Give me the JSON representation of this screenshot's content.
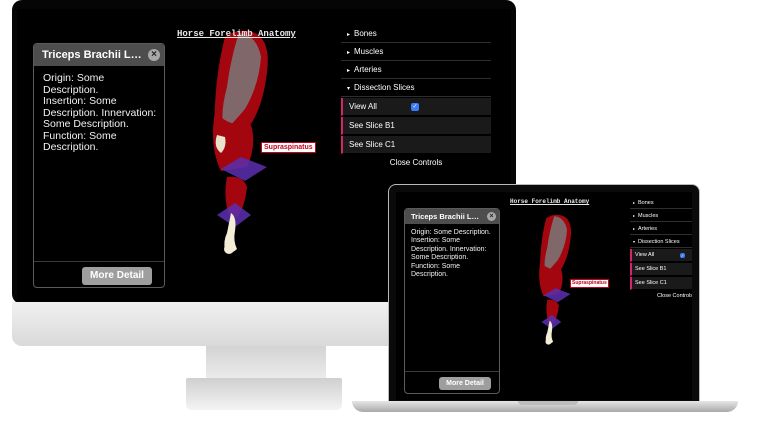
{
  "app": {
    "title": "Horse Forelimb Anatomy"
  },
  "info_panel": {
    "title": "Triceps Brachii Lon...",
    "close_glyph": "×",
    "body": "Origin: Some Description.\nInsertion: Some Description. Innervation: Some Description.\nFunction: Some Description.",
    "more_detail_label": "More Detail"
  },
  "controls": {
    "folders": [
      {
        "label": "Bones",
        "arrow": "▸"
      },
      {
        "label": "Muscles",
        "arrow": "▸"
      },
      {
        "label": "Arteries",
        "arrow": "▸"
      },
      {
        "label": "Dissection Slices",
        "arrow": "▾"
      }
    ],
    "slices": [
      {
        "label": "View All",
        "checked": true
      },
      {
        "label": "See Slice B1"
      },
      {
        "label": "See Slice C1"
      }
    ],
    "check_glyph": "✓",
    "close_label": "Close Controls"
  },
  "model": {
    "tag_label": "Supraspinatus"
  },
  "colors": {
    "muscle": "#a3060f",
    "bone": "#f3edd6",
    "slice_plane": "#5a2fb0",
    "accent": "#d4246a",
    "checkbox": "#3b7bf6"
  }
}
